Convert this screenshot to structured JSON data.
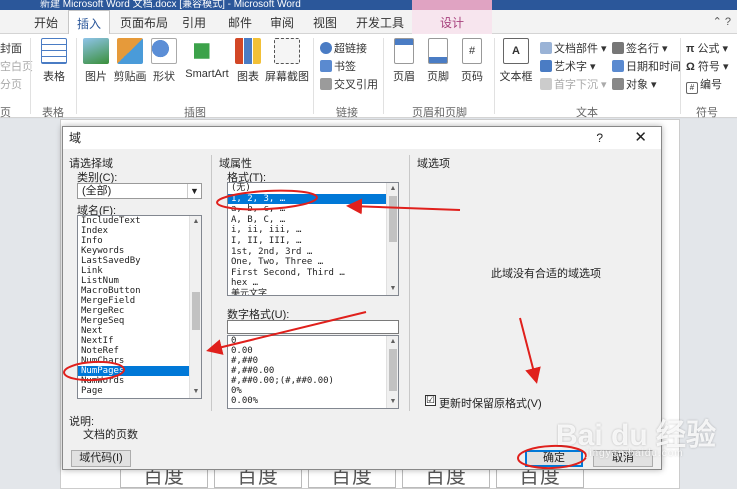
{
  "window": {
    "title": "新建 Microsoft Word 文档.docx [兼容模式] - Microsoft Word"
  },
  "tabs": [
    "开始",
    "插入",
    "页面布局",
    "引用",
    "邮件",
    "审阅",
    "视图",
    "开发工具",
    "设计"
  ],
  "ribbon": {
    "left_cut": [
      "封面",
      "空白页",
      "分页"
    ],
    "left_cut_group": "页",
    "buttons": {
      "table": "表格",
      "picture": "图片",
      "clipart": "剪贴画",
      "shapes": "形状",
      "smartart": "SmartArt",
      "chart": "图表",
      "screenshot": "屏幕截图",
      "header": "页眉",
      "footer": "页脚",
      "page_number": "页码",
      "textbox": "文本框"
    },
    "links": {
      "hyperlink": "超链接",
      "bookmark": "书签",
      "crossref": "交叉引用"
    },
    "text_small": {
      "quickparts": "文档部件",
      "wordart": "艺术字",
      "dropcap": "首字下沉",
      "signature": "签名行",
      "datetime": "日期和时间",
      "object": "对象"
    },
    "symbols": {
      "equation": "公式",
      "symbol": "符号",
      "number": "编号"
    },
    "groups": {
      "table": "表格",
      "illustrations": "插图",
      "links": "链接",
      "header_footer": "页眉和页脚",
      "text": "文本",
      "symbols": "符号"
    }
  },
  "dialog": {
    "title": "域",
    "help": "?",
    "close": "✕",
    "choose_field": "请选择域",
    "category_label": "类别(C):",
    "category_value": "(全部)",
    "field_names_label": "域名(F):",
    "field_names": [
      "IncludeText",
      "Index",
      "Info",
      "Keywords",
      "LastSavedBy",
      "Link",
      "ListNum",
      "MacroButton",
      "MergeField",
      "MergeRec",
      "MergeSeq",
      "Next",
      "NextIf",
      "NoteRef",
      "NumChars",
      "NumPages",
      "NumWords",
      "Page"
    ],
    "field_selected": "NumPages",
    "field_props": "域属性",
    "format_label": "格式(T):",
    "formats": [
      "(无)",
      "1, 2, 3, …",
      "a, b, c, …",
      "A, B, C, …",
      "i, ii, iii, …",
      "I, II, III, …",
      "1st, 2nd, 3rd …",
      "One, Two, Three …",
      "First Second, Third …",
      "hex …",
      "美元文字"
    ],
    "format_selected": "1, 2, 3, …",
    "number_format_label": "数字格式(U):",
    "number_formats": [
      "0",
      "0.00",
      "#,##0",
      "#,##0.00",
      "#,##0.00;(#,##0.00)",
      "0%",
      "0.00%"
    ],
    "field_options": "域选项",
    "no_options": "此域没有合适的域选项",
    "preserve_label": "更新时保留原格式(V)",
    "preserve_checked": "☑",
    "description_label": "说明:",
    "description": "文档的页数",
    "field_codes_button": "域代码(I)",
    "ok_button": "确定",
    "cancel_button": "取消"
  },
  "document": {
    "watermark_text": [
      "百度",
      "百度",
      "百度",
      "百度",
      "百度"
    ]
  },
  "brand": {
    "logo": "Bai du 经验",
    "url": "jingyan.baidu.com"
  },
  "colors": {
    "ribbon_blue": "#2b579a",
    "selection": "#0078d7",
    "annotation_red": "#e0201c"
  }
}
